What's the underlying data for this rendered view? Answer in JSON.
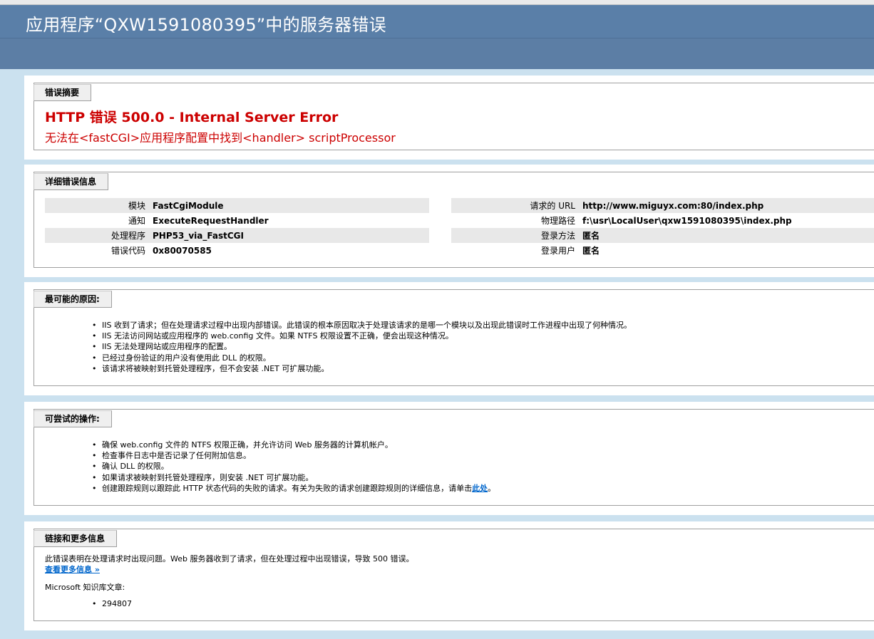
{
  "window": {
    "title": "应用程序“QXW1591080395”中的服务器错误"
  },
  "summary": {
    "legend": "错误摘要",
    "title": "HTTP 错误 500.0 - Internal Server Error",
    "subtitle": "无法在<fastCGI>应用程序配置中找到<handler> scriptProcessor"
  },
  "details": {
    "legend": "详细错误信息",
    "left": [
      {
        "key": "模块",
        "value": "FastCgiModule"
      },
      {
        "key": "通知",
        "value": "ExecuteRequestHandler"
      },
      {
        "key": "处理程序",
        "value": "PHP53_via_FastCGI"
      },
      {
        "key": "错误代码",
        "value": "0x80070585"
      }
    ],
    "right": [
      {
        "key": "请求的 URL",
        "value": "http://www.miguyx.com:80/index.php"
      },
      {
        "key": "物理路径",
        "value": "f:\\usr\\LocalUser\\qxw1591080395\\index.php"
      },
      {
        "key": "登录方法",
        "value": "匿名"
      },
      {
        "key": "登录用户",
        "value": "匿名"
      }
    ]
  },
  "causes": {
    "legend": "最可能的原因:",
    "items": [
      "IIS 收到了请求；但在处理请求过程中出现内部错误。此错误的根本原因取决于处理该请求的是哪一个模块以及出现此错误时工作进程中出现了何种情况。",
      "IIS 无法访问网站或应用程序的 web.config 文件。如果 NTFS 权限设置不正确，便会出现这种情况。",
      "IIS 无法处理网站或应用程序的配置。",
      "已经过身份验证的用户没有使用此 DLL 的权限。",
      "该请求将被映射到托管处理程序，但不会安装 .NET 可扩展功能。"
    ]
  },
  "actions": {
    "legend": "可尝试的操作:",
    "items": [
      "确保 web.config 文件的 NTFS 权限正确，并允许访问 Web 服务器的计算机帐户。",
      "检查事件日志中是否记录了任何附加信息。",
      "确认 DLL 的权限。",
      "如果请求被映射到托管处理程序，则安装 .NET 可扩展功能。"
    ],
    "last_item_prefix": "创建跟踪规则以跟踪此 HTTP 状态代码的失败的请求。有关为失败的请求创建跟踪规则的详细信息，请单击",
    "last_item_link": "此处",
    "last_item_suffix": "。"
  },
  "links": {
    "legend": "链接和更多信息",
    "description": "此错误表明在处理请求时出现问题。Web 服务器收到了请求，但在处理过程中出现错误，导致 500 错误。",
    "more_info_link": "查看更多信息 »",
    "kb_label": "Microsoft 知识库文章:",
    "kb_items": [
      "294807"
    ]
  }
}
